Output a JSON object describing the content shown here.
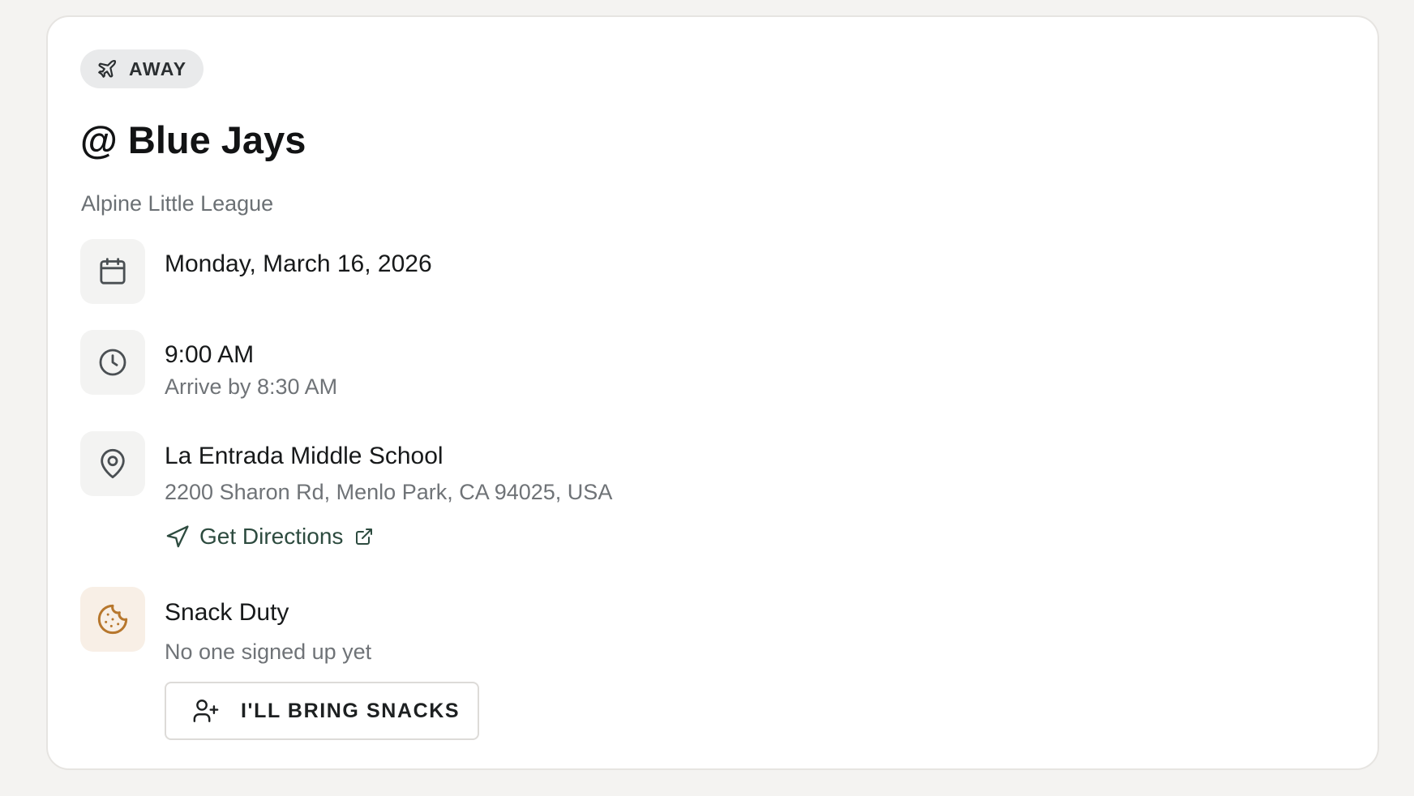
{
  "event": {
    "badge": {
      "label": "AWAY",
      "icon": "plane-icon"
    },
    "title": "@ Blue Jays",
    "league": "Alpine Little League"
  },
  "details": {
    "date": {
      "icon": "calendar-icon",
      "value": "Monday, March 16, 2026"
    },
    "time": {
      "icon": "clock-icon",
      "value": "9:00 AM",
      "arrival": "Arrive by 8:30 AM"
    },
    "location": {
      "icon": "map-pin-icon",
      "name": "La Entrada Middle School",
      "address": "2200 Sharon Rd, Menlo Park, CA 94025, USA",
      "directions_label": "Get Directions",
      "directions_icon": "navigation-icon",
      "external_icon": "external-link-icon"
    },
    "snack": {
      "icon": "cookie-icon",
      "title": "Snack Duty",
      "status": "No one signed up yet",
      "button_label": "I'LL BRING SNACKS",
      "button_icon": "user-plus-icon"
    }
  },
  "colors": {
    "page_background": "#f4f3f1",
    "card_background": "#ffffff",
    "badge_background": "#e9eaeb",
    "icon_tile_background": "#f3f3f2",
    "snack_tile_background": "#f8efe6",
    "snack_icon": "#b7772d",
    "link": "#2d4b3f",
    "secondary_text": "#6f7377"
  }
}
